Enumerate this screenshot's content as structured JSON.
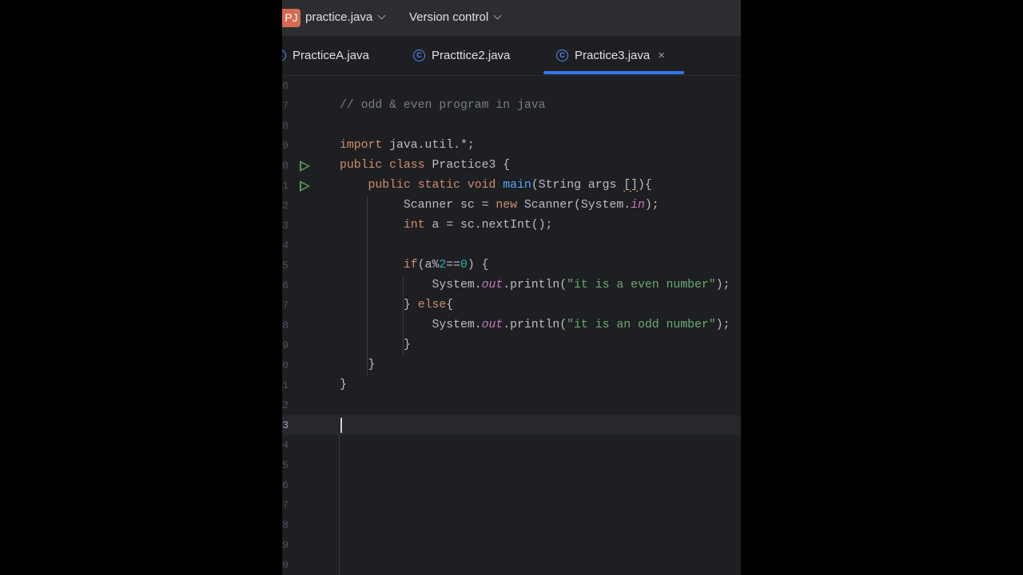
{
  "titlebar": {
    "project_badge": "PJ",
    "project_name": "practice.java",
    "vcs_label": "Version control"
  },
  "tabs": [
    {
      "label": "PracticeA.java",
      "active": false
    },
    {
      "label": "Practtice2.java",
      "active": false
    },
    {
      "label": "Practice3.java",
      "active": true
    }
  ],
  "editor": {
    "line_numbers": [
      "6",
      "7",
      "8",
      "9",
      "0",
      "1",
      "2",
      "3",
      "4",
      "5",
      "6",
      "7",
      "8",
      "9",
      "0",
      "1",
      "2",
      "3",
      "4",
      "5",
      "6",
      "7",
      "8",
      "9",
      "0"
    ],
    "current_line_number": "3",
    "comment": "// odd & even program in java",
    "import_kw": "import",
    "import_rest": " java.util.*;",
    "public_kw": "public",
    "class_kw": " class",
    "class_name": " Practice3 {",
    "static_kw": " static",
    "void_kw": " void",
    "main_name": "main",
    "main_params_a": "(String args ",
    "main_params_brackets": "[]",
    "main_params_b": "){",
    "scanner_a": "Scanner sc = ",
    "new_kw": "new",
    "scanner_b": " Scanner(System.",
    "in_field": "in",
    "scanner_c": ");",
    "int_kw": "int",
    "int_rest": " a = sc.nextInt();",
    "if_kw": "if",
    "if_a": "(a%",
    "num_two": "2",
    "if_b": "==",
    "num_zero": "0",
    "if_c": ") {",
    "sys": "System.",
    "out_field": "out",
    "println_open": ".println(",
    "even_str": "\"it is a even number\"",
    "odd_str": "\"it is an odd number\"",
    "println_close": ");",
    "close_brace_else": "} ",
    "else_kw": "else",
    "else_brace": "{",
    "close_brace": "}"
  }
}
